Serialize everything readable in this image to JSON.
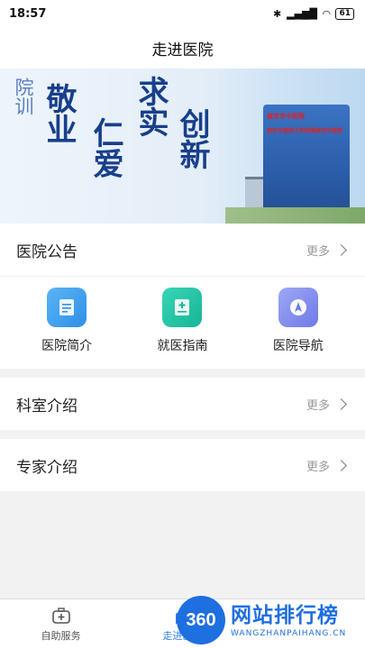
{
  "status_bar": {
    "time": "18:57",
    "battery": "61"
  },
  "nav": {
    "title": "走进医院"
  },
  "banner": {
    "small": "院训",
    "motto_1": "敬业",
    "motto_2": "仁爱",
    "motto_3": "求实",
    "motto_4": "创新",
    "sign_1": "南京市中医院",
    "sign_2": "南京中医药大学附属南京中医院"
  },
  "announcement": {
    "title": "医院公告",
    "more": "更多"
  },
  "quick_links": [
    {
      "label": "医院简介",
      "icon": "document-icon",
      "color": "#2f8fe8"
    },
    {
      "label": "就医指南",
      "icon": "medical-card-icon",
      "color": "#17b595"
    },
    {
      "label": "医院导航",
      "icon": "navigation-arrow-icon",
      "color": "#6f79e6"
    }
  ],
  "departments": {
    "title": "科室介绍",
    "more": "更多"
  },
  "experts": {
    "title": "专家介绍",
    "more": "更多"
  },
  "tabs": [
    {
      "label": "自助服务",
      "icon": "medical-kit-icon"
    },
    {
      "label": "走进医院",
      "icon": "hospital-icon"
    }
  ],
  "watermark": {
    "logo": "360",
    "text": "网站排行榜",
    "sub": "WANGZHANPAIHANG.CN"
  }
}
